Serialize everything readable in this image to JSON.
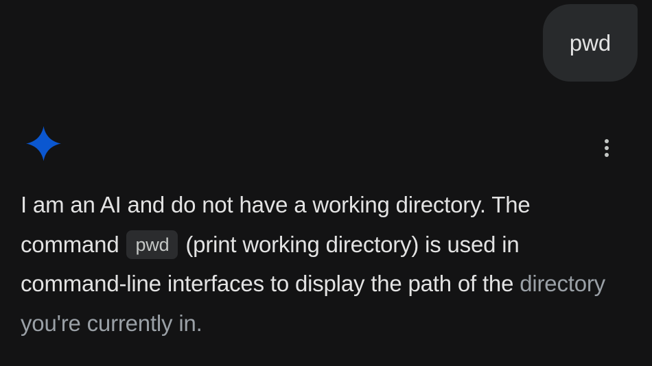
{
  "user_message": {
    "text": "pwd"
  },
  "assistant": {
    "icon": "gemini-spark-icon",
    "more_icon": "more-vertical-icon",
    "response": {
      "part1": "I am an AI and do not have a working directory. The command",
      "code": "pwd",
      "part2": "(print working directory) is used in command-line interfaces to display the path of the",
      "faded": "directory you're currently in."
    }
  },
  "colors": {
    "background": "#131314",
    "bubble": "#282a2c",
    "spark": "#0b57d0",
    "text": "#e3e3e3",
    "faded_text": "#9aa0a6"
  }
}
